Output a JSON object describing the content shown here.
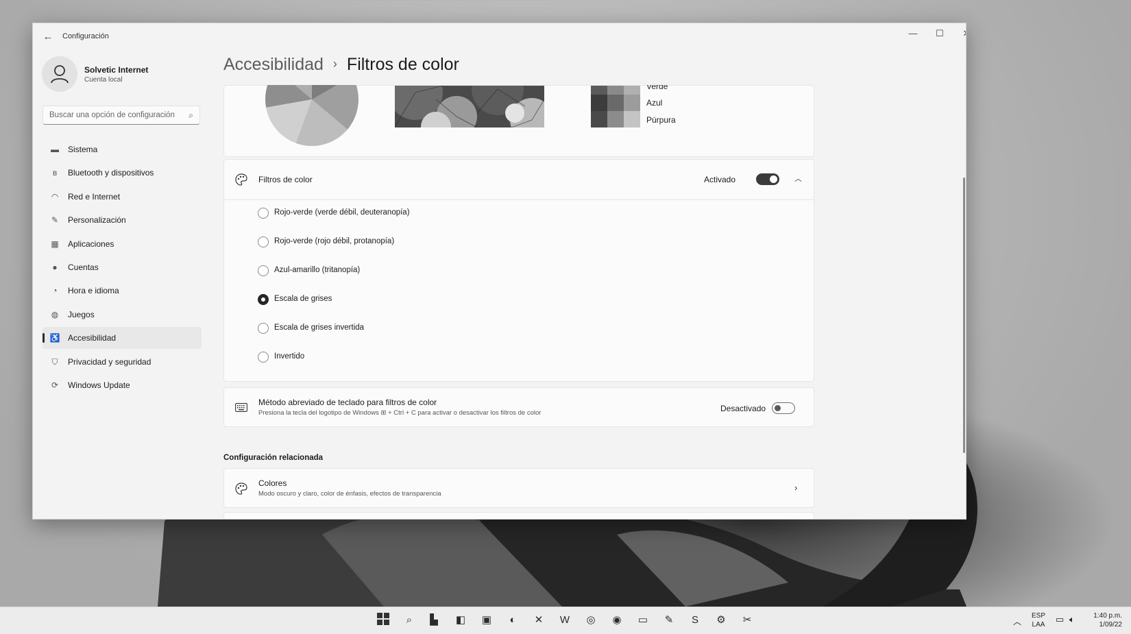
{
  "window": {
    "app_title": "Configuración",
    "back_icon": "arrow-left-icon",
    "controls": [
      "minimize-icon",
      "maximize-icon",
      "close-icon"
    ]
  },
  "profile": {
    "name": "Solvetic Internet",
    "account_type": "Cuenta local"
  },
  "search": {
    "placeholder": "Buscar una opción de configuración",
    "icon": "search-icon"
  },
  "sidebar": {
    "items": [
      {
        "label": "Sistema",
        "icon": "monitor-icon"
      },
      {
        "label": "Bluetooth y dispositivos",
        "icon": "bluetooth-icon"
      },
      {
        "label": "Red e Internet",
        "icon": "wifi-icon"
      },
      {
        "label": "Personalización",
        "icon": "brush-icon"
      },
      {
        "label": "Aplicaciones",
        "icon": "apps-icon"
      },
      {
        "label": "Cuentas",
        "icon": "person-icon"
      },
      {
        "label": "Hora e idioma",
        "icon": "clock-globe-icon"
      },
      {
        "label": "Juegos",
        "icon": "gamepad-icon"
      },
      {
        "label": "Accesibilidad",
        "icon": "accessibility-icon",
        "active": true
      },
      {
        "label": "Privacidad y seguridad",
        "icon": "shield-icon"
      },
      {
        "label": "Windows Update",
        "icon": "update-icon"
      }
    ]
  },
  "breadcrumb": {
    "parent": "Accesibilidad",
    "separator": "›",
    "current": "Filtros de color"
  },
  "preview": {
    "swatch_labels": [
      "Verde",
      "Azul",
      "Púrpura"
    ]
  },
  "color_filters": {
    "title": "Filtros de color",
    "state": "Activado",
    "enabled": true,
    "options": [
      {
        "label": "Rojo-verde (verde débil, deuteranopía)",
        "checked": false
      },
      {
        "label": "Rojo-verde (rojo débil, protanopía)",
        "checked": false
      },
      {
        "label": "Azul-amarillo (tritanopía)",
        "checked": false
      },
      {
        "label": "Escala de grises",
        "checked": true
      },
      {
        "label": "Escala de grises invertida",
        "checked": false
      },
      {
        "label": "Invertido",
        "checked": false
      }
    ]
  },
  "shortcut": {
    "title": "Método abreviado de teclado para filtros de color",
    "description": "Presiona la tecla del logotipo de Windows ⊞ + Ctrl + C para activar o desactivar los filtros de color",
    "state": "Desactivado",
    "enabled": false
  },
  "related": {
    "heading": "Configuración relacionada",
    "colors_title": "Colores",
    "colors_desc": "Modo oscuro y claro, color de énfasis, efectos de transparencia"
  },
  "taskbar": {
    "icons": [
      "windows-start-icon",
      "search-icon",
      "task-view-icon",
      "widgets-icon",
      "chat-icon",
      "edge-icon",
      "excel-icon",
      "word-icon",
      "chrome-icon",
      "chrome-canary-icon",
      "file-explorer-icon",
      "notepad-icon",
      "skype-icon",
      "settings-icon",
      "snipping-tool-icon"
    ],
    "language_top": "ESP",
    "language_bottom": "LAA",
    "time": "1:40 p.m.",
    "date": "1/09/22"
  },
  "colors": {
    "window_bg": "#f3f3f3",
    "card_bg": "#fbfbfb",
    "accent": "#3b3b3b"
  }
}
